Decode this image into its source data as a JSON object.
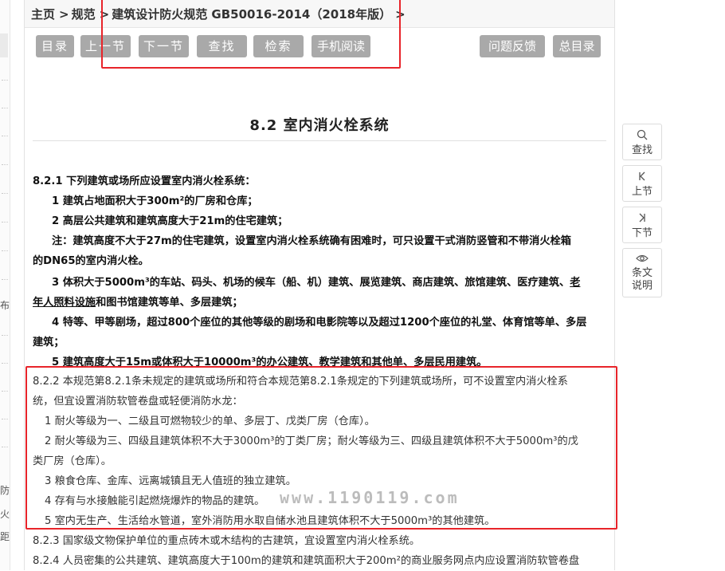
{
  "left_sidebar": {
    "fragments": [
      "布",
      "防",
      "火",
      "距"
    ]
  },
  "breadcrumb": {
    "home": "主页",
    "sep": ">",
    "category": "规范",
    "current": "建筑设计防火规范 GB50016-2014（2018年版）"
  },
  "toolbar": {
    "toc": "目录",
    "prev": "上一节",
    "next": "下一节",
    "find": "查找",
    "search": "检索",
    "mobile": "手机阅读",
    "feedback": "问题反馈",
    "main_toc": "总目录"
  },
  "section": {
    "title": "8.2 室内消火栓系统"
  },
  "content": {
    "c821": {
      "head": "8.2.1 下列建筑或场所应设置室内消火栓系统：",
      "i1": "1 建筑占地面积大于300m²的厂房和仓库；",
      "i2": "2 高层公共建筑和建筑高度大于21m的住宅建筑；",
      "note_l1": "注：建筑高度不大于27m的住宅建筑，设置室内消火栓系统确有困难时，可只设置干式消防竖管和不带消火栓箱",
      "note_l2": "的DN65的室内消火栓。",
      "i3_l1a": "3 体积大于5000m³的车站、码头、机场的候车（船、机）建筑、展览建筑、商店建筑、旅馆建筑、医疗建筑、",
      "i3_l1b": "老",
      "i3_l2a": "年人照料设施",
      "i3_l2b": "和图书馆建筑等单、多层建筑；",
      "i4_l1": "4 特等、甲等剧场，超过800个座位的其他等级的剧场和电影院等以及超过1200个座位的礼堂、体育馆等单、多层",
      "i4_l2": "建筑；",
      "i5": "5 建筑高度大于15m或体积大于10000m³的办公建筑、教学建筑和其他单、多层民用建筑。"
    },
    "c822": {
      "head_l1": "8.2.2 本规范第8.2.1条未规定的建筑或场所和符合本规范第8.2.1条规定的下列建筑或场所，可不设置室内消火栓系",
      "head_l2": "统，但宜设置消防软管卷盘或轻便消防水龙：",
      "i1": "1 耐火等级为一、二级且可燃物较少的单、多层丁、戊类厂房（仓库）。",
      "i2_l1": "2 耐火等级为三、四级且建筑体积不大于3000m³的丁类厂房；耐火等级为三、四级且建筑体积不大于5000m³的戊",
      "i2_l2": "类厂房（仓库）。",
      "i3": "3 粮食仓库、金库、远离城镇且无人值班的独立建筑。",
      "i4": "4 存有与水接触能引起燃烧爆炸的物品的建筑。",
      "i5": "5 室内无生产、生活给水管道，室外消防用水取自储水池且建筑体积不大于5000m³的其他建筑。"
    },
    "c823": "8.2.3 国家级文物保护单位的重点砖木或木结构的古建筑，宜设置室内消火栓系统。",
    "c824": "8.2.4 人员密集的公共建筑、建筑高度大于100m的建筑和建筑面积大于200m²的商业服务网点内应设置消防软管卷盘"
  },
  "watermark": "www.1190119.com",
  "side_tools": {
    "find": {
      "icon": "search-icon",
      "label": "查找"
    },
    "prev": {
      "icon": "skip-back-icon",
      "label": "上节"
    },
    "next": {
      "icon": "skip-forward-icon",
      "label": "下节"
    },
    "notes": {
      "icon": "eye-icon",
      "label_l1": "条文",
      "label_l2": "说明"
    }
  },
  "colors": {
    "button_bg": "#a9a9a9",
    "highlight_red": "#e8242a",
    "breadcrumb_bg": "#f7f7f7"
  }
}
